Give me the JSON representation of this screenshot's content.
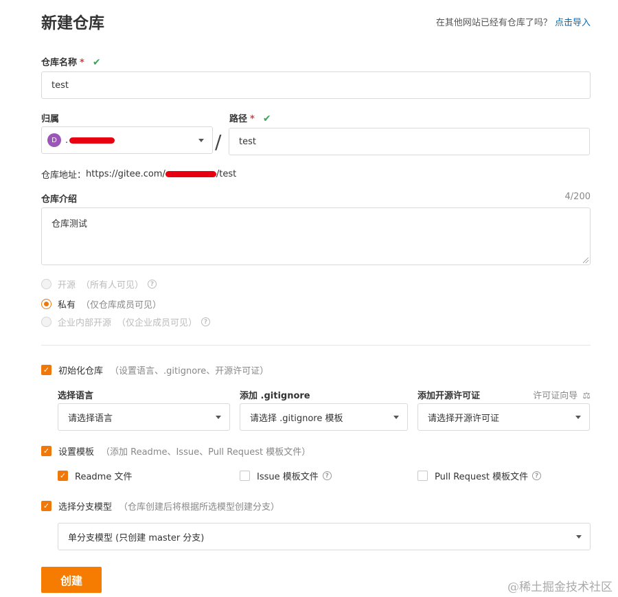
{
  "header": {
    "title": "新建仓库",
    "import_hint": "在其他网站已经有仓库了吗？",
    "import_link": "点击导入"
  },
  "repo_name": {
    "label": "仓库名称",
    "required_mark": "*",
    "valid_mark": "✔",
    "value": "test"
  },
  "owner": {
    "label": "归属",
    "avatar_letter": "D",
    "visible_prefix": "."
  },
  "path": {
    "label": "路径",
    "required_mark": "*",
    "valid_mark": "✔",
    "separator": "/",
    "value": "test"
  },
  "address": {
    "label": "仓库地址：",
    "url_prefix": "https://gitee.com/",
    "url_suffix": "/test"
  },
  "description": {
    "label": "仓库介绍",
    "counter": "4/200",
    "value": "仓库测试"
  },
  "visibility": {
    "options": [
      {
        "label": "开源",
        "note": "（所有人可见）",
        "selected": false,
        "disabled": true
      },
      {
        "label": "私有",
        "note": "（仅仓库成员可见）",
        "selected": true,
        "disabled": false
      },
      {
        "label": "企业内部开源",
        "note": "（仅企业成员可见）",
        "selected": false,
        "disabled": true
      }
    ]
  },
  "init_repo": {
    "label": "初始化仓库",
    "note": "（设置语言、.gitignore、开源许可证）",
    "checked": true,
    "language_label": "选择语言",
    "language_placeholder": "请选择语言",
    "gitignore_label": "添加 .gitignore",
    "gitignore_placeholder": "请选择 .gitignore 模板",
    "license_label": "添加开源许可证",
    "license_guide": "许可证向导",
    "license_placeholder": "请选择开源许可证"
  },
  "templates": {
    "label": "设置模板",
    "note": "（添加 Readme、Issue、Pull Request 模板文件）",
    "checked": true,
    "items": [
      {
        "label": "Readme 文件",
        "checked": true
      },
      {
        "label": "Issue 模板文件",
        "checked": false
      },
      {
        "label": "Pull Request 模板文件",
        "checked": false
      }
    ]
  },
  "branch_model": {
    "label": "选择分支模型",
    "note": "（仓库创建后将根据所选模型创建分支）",
    "checked": true,
    "selected": "单分支模型 (只创建 master 分支)"
  },
  "actions": {
    "create_label": "创建"
  },
  "watermark": "@稀土掘金技术社区",
  "colors": {
    "accent": "#f57c00",
    "link": "#0a6ab4",
    "valid": "#34a853",
    "required": "#e4393c"
  }
}
